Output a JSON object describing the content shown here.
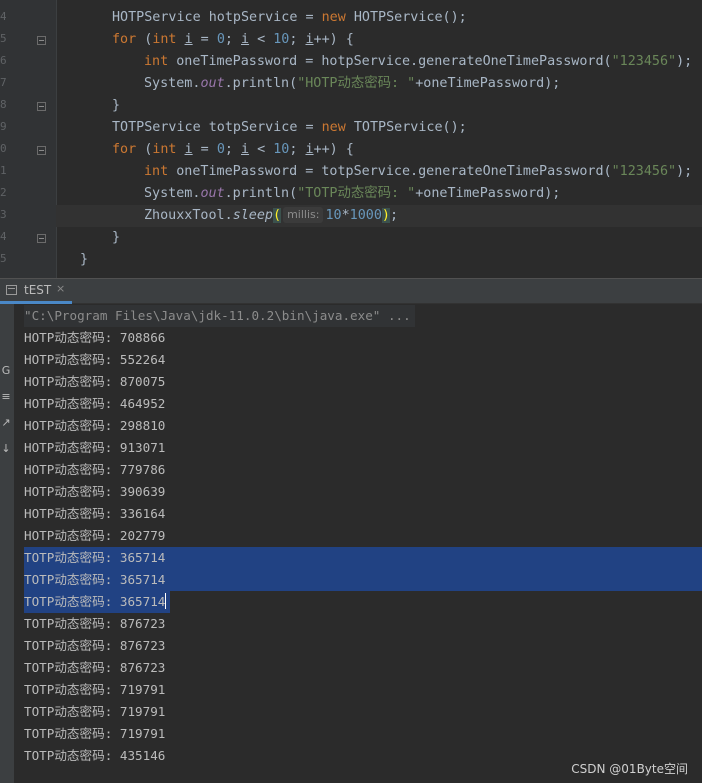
{
  "editor": {
    "line_numbers": [
      "4",
      "5",
      "6",
      "7",
      "8",
      "9",
      "0",
      "1",
      "2",
      "3",
      "4",
      "5"
    ],
    "lines": [
      {
        "indent": 2,
        "parts": [
          [
            "plain",
            "HOTPService hotpService = "
          ],
          [
            "kw",
            "new "
          ],
          [
            "plain",
            "HOTPService();"
          ]
        ]
      },
      {
        "indent": 2,
        "parts": [
          [
            "kw",
            "for "
          ],
          [
            "plain",
            "("
          ],
          [
            "kw",
            "int "
          ],
          [
            "u",
            "i"
          ],
          [
            "plain",
            " = "
          ],
          [
            "num",
            "0"
          ],
          [
            "plain",
            "; "
          ],
          [
            "u",
            "i"
          ],
          [
            "plain",
            " < "
          ],
          [
            "num",
            "10"
          ],
          [
            "plain",
            "; "
          ],
          [
            "u",
            "i"
          ],
          [
            "plain",
            "++) {"
          ]
        ]
      },
      {
        "indent": 3,
        "parts": [
          [
            "kw",
            "int "
          ],
          [
            "plain",
            "oneTimePassword = hotpService.generateOneTimePassword("
          ],
          [
            "str",
            "\"123456\""
          ],
          [
            "plain",
            ");"
          ]
        ]
      },
      {
        "indent": 3,
        "parts": [
          [
            "plain",
            "System."
          ],
          [
            "fld",
            "out"
          ],
          [
            "plain",
            ".println("
          ],
          [
            "str",
            "\"HOTP动态密码: \""
          ],
          [
            "plain",
            "+oneTimePassword);"
          ]
        ]
      },
      {
        "indent": 2,
        "parts": [
          [
            "plain",
            "}"
          ]
        ]
      },
      {
        "indent": 2,
        "parts": [
          [
            "plain",
            "TOTPService totpService = "
          ],
          [
            "kw",
            "new "
          ],
          [
            "plain",
            "TOTPService();"
          ]
        ]
      },
      {
        "indent": 2,
        "parts": [
          [
            "kw",
            "for "
          ],
          [
            "plain",
            "("
          ],
          [
            "kw",
            "int "
          ],
          [
            "u",
            "i"
          ],
          [
            "plain",
            " = "
          ],
          [
            "num",
            "0"
          ],
          [
            "plain",
            "; "
          ],
          [
            "u",
            "i"
          ],
          [
            "plain",
            " < "
          ],
          [
            "num",
            "10"
          ],
          [
            "plain",
            "; "
          ],
          [
            "u",
            "i"
          ],
          [
            "plain",
            "++) {"
          ]
        ]
      },
      {
        "indent": 3,
        "parts": [
          [
            "kw",
            "int "
          ],
          [
            "plain",
            "oneTimePassword = totpService.generateOneTimePassword("
          ],
          [
            "str",
            "\"123456\""
          ],
          [
            "plain",
            ");"
          ]
        ]
      },
      {
        "indent": 3,
        "parts": [
          [
            "plain",
            "System."
          ],
          [
            "fld",
            "out"
          ],
          [
            "plain",
            ".println("
          ],
          [
            "str",
            "\"TOTP动态密码: \""
          ],
          [
            "plain",
            "+oneTimePassword);"
          ]
        ]
      },
      {
        "indent": 3,
        "current": true,
        "parts": [
          [
            "plain",
            "ZhouxxTool."
          ],
          [
            "it",
            "sleep"
          ],
          [
            "hl",
            "("
          ],
          [
            "hint",
            "millis:"
          ],
          [
            "num",
            "10"
          ],
          [
            "plain",
            "*"
          ],
          [
            "num",
            "1000"
          ],
          [
            "hl",
            ")"
          ],
          [
            "plain",
            ";"
          ]
        ]
      },
      {
        "indent": 2,
        "parts": [
          [
            "plain",
            "}"
          ]
        ]
      },
      {
        "indent": 1,
        "parts": [
          [
            "plain",
            "}"
          ]
        ]
      }
    ]
  },
  "tool_window": {
    "tab_label": "tEST",
    "tab_close": "×",
    "side_glyphs": [
      "G",
      "≡",
      "↗",
      "↓"
    ]
  },
  "console": {
    "command": "\"C:\\Program Files\\Java\\jdk-11.0.2\\bin\\java.exe\" ...",
    "lines": [
      "HOTP动态密码: 708866",
      "HOTP动态密码: 552264",
      "HOTP动态密码: 870075",
      "HOTP动态密码: 464952",
      "HOTP动态密码: 298810",
      "HOTP动态密码: 913071",
      "HOTP动态密码: 779786",
      "HOTP动态密码: 390639",
      "HOTP动态密码: 336164",
      "HOTP动态密码: 202779",
      "TOTP动态密码: 365714",
      "TOTP动态密码: 365714",
      "TOTP动态密码: 365714",
      "TOTP动态密码: 876723",
      "TOTP动态密码: 876723",
      "TOTP动态密码: 876723",
      "TOTP动态密码: 719791",
      "TOTP动态密码: 719791",
      "TOTP动态密码: 719791",
      "TOTP动态密码: 435146"
    ],
    "selected_line_indices": [
      10,
      11,
      12
    ]
  },
  "watermark": "CSDN @01Byte空间",
  "colors": {
    "keyword": "#cc7832",
    "number": "#6897bb",
    "string": "#6a8759",
    "field": "#9876aa",
    "selection": "#214283"
  }
}
